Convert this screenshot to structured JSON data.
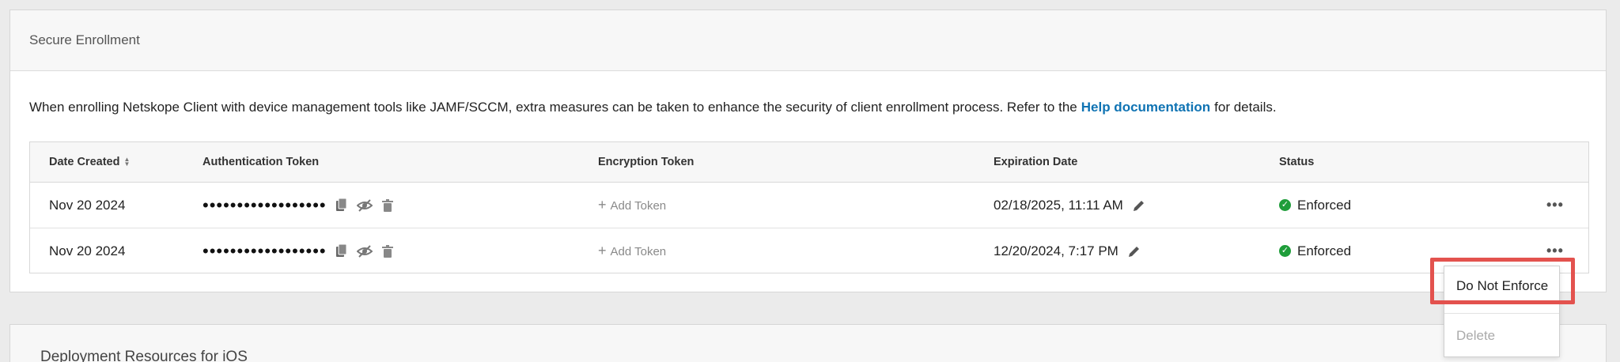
{
  "secure_enrollment": {
    "title": "Secure Enrollment",
    "description_before": "When enrolling Netskope Client with device management tools like JAMF/SCCM, extra measures can be taken to enhance the security of client enrollment process. Refer to the",
    "help_link": "Help documentation",
    "description_after": "for details."
  },
  "table": {
    "headers": {
      "date_created": "Date Created",
      "auth_token": "Authentication Token",
      "encryption_token": "Encryption Token",
      "expiration_date": "Expiration Date",
      "status": "Status"
    },
    "rows": [
      {
        "date_created": "Nov 20 2024",
        "auth_token": "••••••••••••••••••",
        "encryption_token": "Add Token",
        "expiration_date": "02/18/2025, 11:11 AM",
        "status": "Enforced"
      },
      {
        "date_created": "Nov 20 2024",
        "auth_token": "••••••••••••••••••",
        "encryption_token": "Add Token",
        "expiration_date": "12/20/2024, 7:17 PM",
        "status": "Enforced"
      }
    ]
  },
  "context_menu": {
    "items": [
      "Do Not Enforce",
      "Delete"
    ]
  },
  "deployment": {
    "title": "Deployment Resources for iOS"
  },
  "colors": {
    "link": "#0f73b3",
    "enforced": "#1f9d3a",
    "highlight": "#e3524e"
  }
}
